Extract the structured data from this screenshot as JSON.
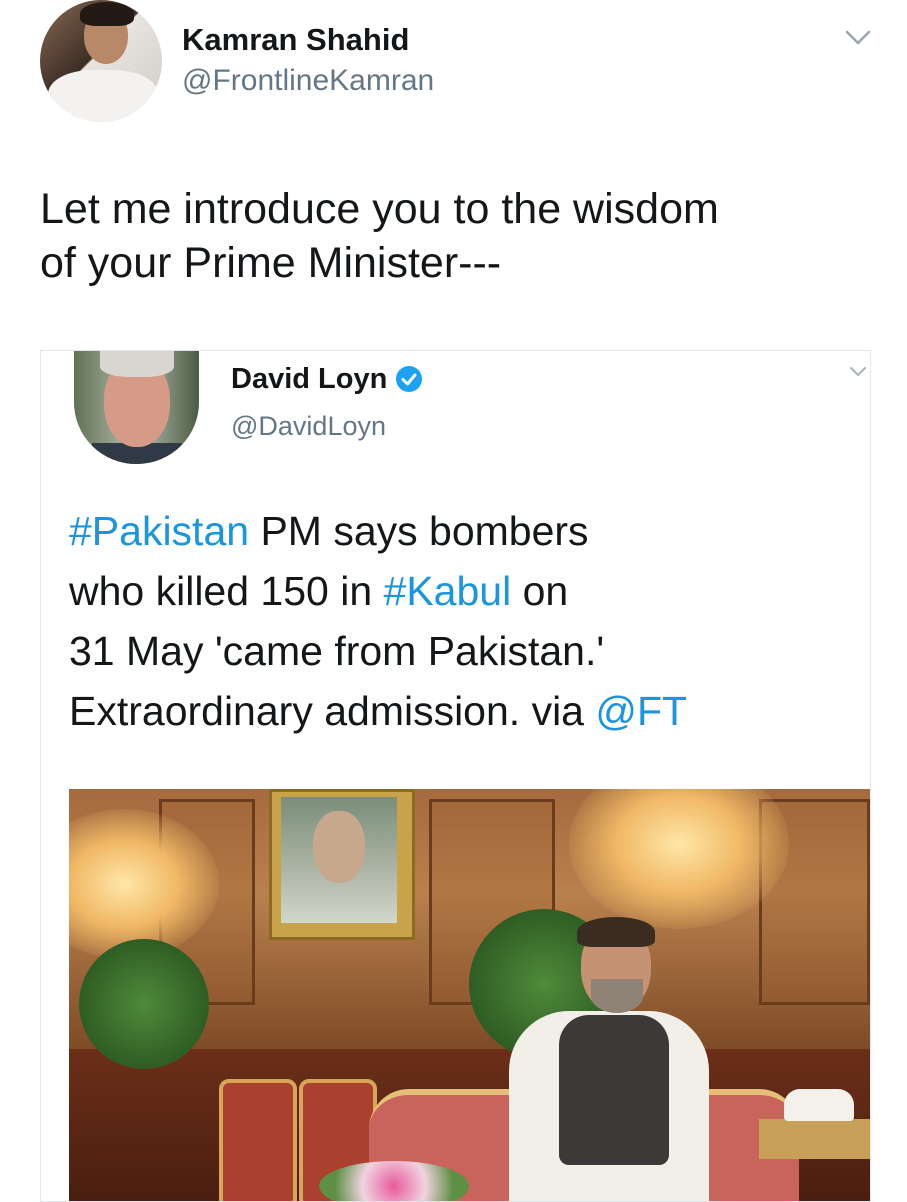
{
  "outer_tweet": {
    "author_name": "Kamran Shahid",
    "author_handle": "@FrontlineKamran",
    "text": "Let me introduce you to the wisdom\nof your Prime Minister---",
    "avatar_icon": "profile-photo",
    "menu_icon": "chevron-down-icon"
  },
  "embedded_tweet": {
    "author_name": "David Loyn",
    "author_handle": "@DavidLoyn",
    "verified_icon": "verified-badge-icon",
    "menu_icon": "chevron-down-icon",
    "text_segments": {
      "hashtag_pakistan": "#Pakistan",
      "seg1": " PM says bombers",
      "seg2": "who killed 150 in ",
      "hashtag_kabul": "#Kabul",
      "seg3": " on",
      "seg4": "31 May 'came from Pakistan.'",
      "seg5": "Extraordinary admission. via ",
      "mention_ft": "@FT"
    },
    "photo_description_icon": "news-photo"
  },
  "colors": {
    "link": "#1b95e0",
    "text_primary": "#14171a",
    "text_secondary": "#657786",
    "verified": "#1da1f2",
    "border": "#e3e6e8"
  }
}
